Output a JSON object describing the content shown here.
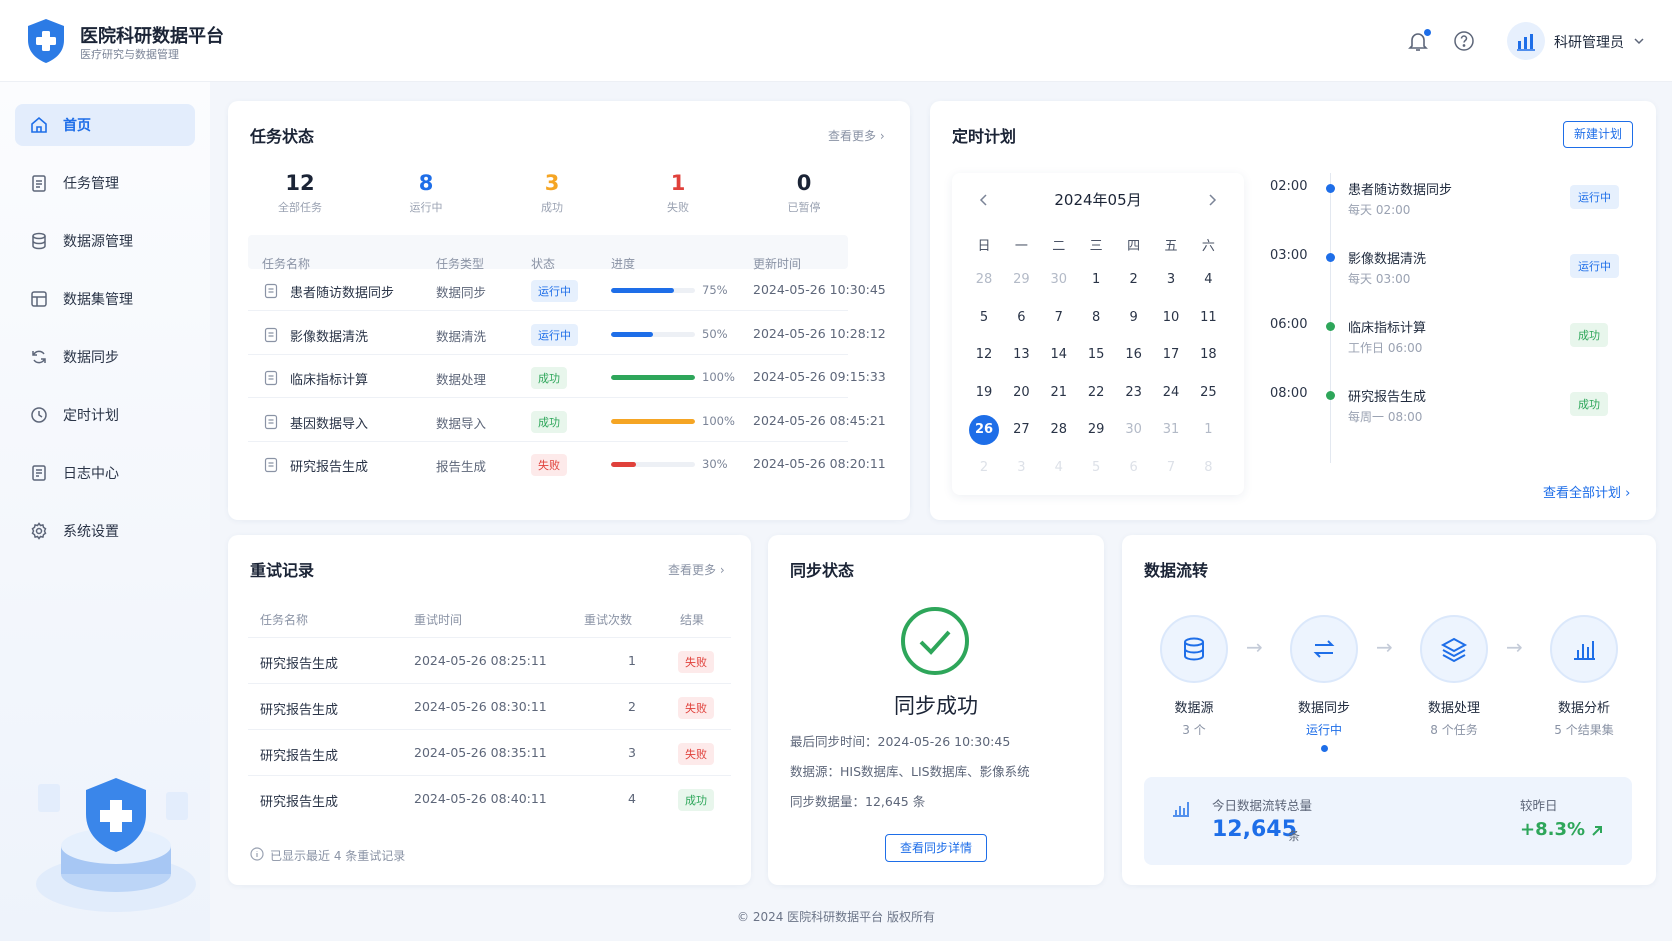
{
  "header": {
    "title": "医院科研数据平台",
    "subtitle": "医疗研究与数据管理",
    "user": "科研管理员"
  },
  "nav": [
    {
      "label": "首页"
    },
    {
      "label": "任务管理"
    },
    {
      "label": "数据源管理"
    },
    {
      "label": "数据集管理"
    },
    {
      "label": "数据同步"
    },
    {
      "label": "定时计划"
    },
    {
      "label": "日志中心"
    },
    {
      "label": "系统设置"
    }
  ],
  "tasks": {
    "title": "任务状态",
    "more": "查看更多 ›",
    "stats": [
      {
        "value": "12",
        "label": "全部任务",
        "color": "#1b2436"
      },
      {
        "value": "8",
        "label": "运行中",
        "color": "#1e6ee8"
      },
      {
        "value": "3",
        "label": "成功",
        "color": "#f5a524"
      },
      {
        "value": "1",
        "label": "失败",
        "color": "#e0413b"
      },
      {
        "value": "0",
        "label": "已暂停",
        "color": "#1b2436"
      }
    ],
    "columns": [
      "任务名称",
      "任务类型",
      "状态",
      "进度",
      "更新时间"
    ],
    "rows": [
      {
        "name": "患者随访数据同步",
        "type": "数据同步",
        "status": "运行中",
        "progress": 75,
        "pct": "75%",
        "time": "2024-05-26 10:30:45",
        "color": "#1e6ee8"
      },
      {
        "name": "影像数据清洗",
        "type": "数据清洗",
        "status": "运行中",
        "progress": 50,
        "pct": "50%",
        "time": "2024-05-26 10:28:12",
        "color": "#1e6ee8"
      },
      {
        "name": "临床指标计算",
        "type": "数据处理",
        "status": "成功",
        "progress": 100,
        "pct": "100%",
        "time": "2024-05-26 09:15:33",
        "color": "#2ea65a"
      },
      {
        "name": "基因数据导入",
        "type": "数据导入",
        "status": "成功",
        "progress": 100,
        "pct": "100%",
        "time": "2024-05-26 08:45:21",
        "color": "#f5a524"
      },
      {
        "name": "研究报告生成",
        "type": "报告生成",
        "status": "失败",
        "progress": 30,
        "pct": "30%",
        "time": "2024-05-26 08:20:11",
        "color": "#e0413b"
      }
    ]
  },
  "schedule": {
    "title": "定时计划",
    "new_btn": "新建计划",
    "month": "2024年05月",
    "weekdays": [
      "日",
      "一",
      "二",
      "三",
      "四",
      "五",
      "六"
    ],
    "days": [
      [
        "28",
        "29",
        "30",
        "1",
        "2",
        "3",
        "4"
      ],
      [
        "5",
        "6",
        "7",
        "8",
        "9",
        "10",
        "11"
      ],
      [
        "12",
        "13",
        "14",
        "15",
        "16",
        "17",
        "18"
      ],
      [
        "19",
        "20",
        "21",
        "22",
        "23",
        "24",
        "25"
      ],
      [
        "26",
        "27",
        "28",
        "29",
        "30",
        "31",
        "1"
      ],
      [
        "2",
        "3",
        "4",
        "5",
        "6",
        "7",
        "8"
      ]
    ],
    "items": [
      {
        "time": "02:00",
        "name": "患者随访数据同步",
        "sub": "每天 02:00",
        "status": "运行中"
      },
      {
        "time": "03:00",
        "name": "影像数据清洗",
        "sub": "每天 03:00",
        "status": "运行中"
      },
      {
        "time": "06:00",
        "name": "临床指标计算",
        "sub": "工作日 06:00",
        "status": "成功"
      },
      {
        "time": "08:00",
        "name": "研究报告生成",
        "sub": "每周一 08:00",
        "status": "成功"
      }
    ],
    "view_all": "查看全部计划 ›"
  },
  "retry": {
    "title": "重试记录",
    "more": "查看更多 ›",
    "columns": [
      "任务名称",
      "重试时间",
      "重试次数",
      "结果"
    ],
    "rows": [
      {
        "name": "研究报告生成",
        "time": "2024-05-26 08:25:11",
        "count": "1",
        "result": "失败"
      },
      {
        "name": "研究报告生成",
        "time": "2024-05-26 08:30:11",
        "count": "2",
        "result": "失败"
      },
      {
        "name": "研究报告生成",
        "time": "2024-05-26 08:35:11",
        "count": "3",
        "result": "失败"
      },
      {
        "name": "研究报告生成",
        "time": "2024-05-26 08:40:11",
        "count": "4",
        "result": "成功"
      }
    ],
    "note": "已显示最近 4 条重试记录"
  },
  "sync": {
    "title": "同步状态",
    "status": "同步成功",
    "last_label": "最后同步时间：",
    "last": "2024-05-26 10:30:45",
    "source_label": "数据源：",
    "source": "HIS数据库、LIS数据库、影像系统",
    "volume_label": "同步数据量：",
    "volume": "12,645 条",
    "btn": "查看同步详情"
  },
  "flow": {
    "title": "数据流转",
    "steps": [
      {
        "name": "数据源",
        "sub": "3 个"
      },
      {
        "name": "数据同步",
        "sub": "运行中"
      },
      {
        "name": "数据处理",
        "sub": "8 个任务"
      },
      {
        "name": "数据分析",
        "sub": "5 个结果集"
      }
    ],
    "total_label": "今日数据流转总量",
    "total": "12,645",
    "unit": "条",
    "cmp_label": "较昨日",
    "cmp": "+8.3%"
  },
  "footer": "© 2024 医院科研数据平台 版权所有"
}
